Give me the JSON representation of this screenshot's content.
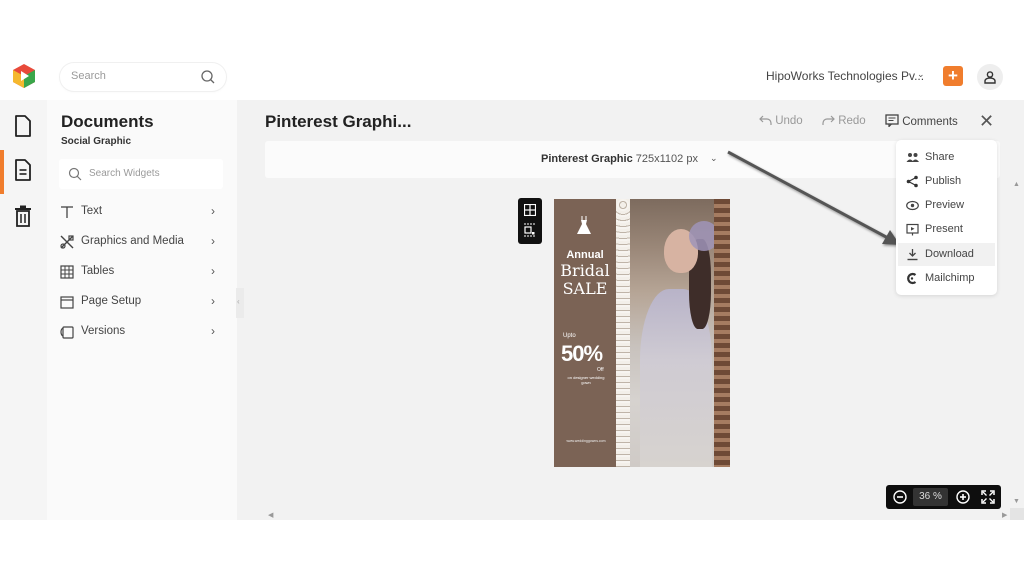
{
  "topbar": {
    "search_placeholder": "Search",
    "company_name": "HipoWorks Technologies Pv...",
    "add_label": "+"
  },
  "panel": {
    "title": "Documents",
    "subtitle": "Social Graphic",
    "search_placeholder": "Search Widgets",
    "items": [
      {
        "label": "Text",
        "icon": "text-icon"
      },
      {
        "label": "Graphics and Media",
        "icon": "graphics-icon"
      },
      {
        "label": "Tables",
        "icon": "table-icon"
      },
      {
        "label": "Page Setup",
        "icon": "page-setup-icon"
      },
      {
        "label": "Versions",
        "icon": "versions-icon"
      }
    ],
    "chevron": "›"
  },
  "editor": {
    "doc_title": "Pinterest Graphi...",
    "undo_label": "Undo",
    "redo_label": "Redo",
    "comments_label": "Comments",
    "close_label": "✕",
    "size_name": "Pinterest Graphic",
    "size_dims": "725x1102 px",
    "caret": "⌄"
  },
  "design": {
    "annual": "Annual",
    "bridal": "Bridal",
    "sale": "SALE",
    "upto": "Upto",
    "percent": "50%",
    "off": "Off",
    "description": "on designer wedding gown",
    "url": "www.weddinggowns.com",
    "colors": {
      "panel": "#7b6355"
    }
  },
  "dropdown": {
    "items": [
      {
        "label": "Share",
        "icon": "share-users-icon"
      },
      {
        "label": "Publish",
        "icon": "publish-share-icon"
      },
      {
        "label": "Preview",
        "icon": "eye-icon"
      },
      {
        "label": "Present",
        "icon": "present-icon"
      },
      {
        "label": "Download",
        "icon": "download-icon",
        "highlighted": true
      },
      {
        "label": "Mailchimp",
        "icon": "mailchimp-icon"
      }
    ]
  },
  "zoom": {
    "value": "36 %"
  },
  "colors": {
    "accent": "#f07d2d",
    "dark_toolbar": "#0e0e0e"
  }
}
